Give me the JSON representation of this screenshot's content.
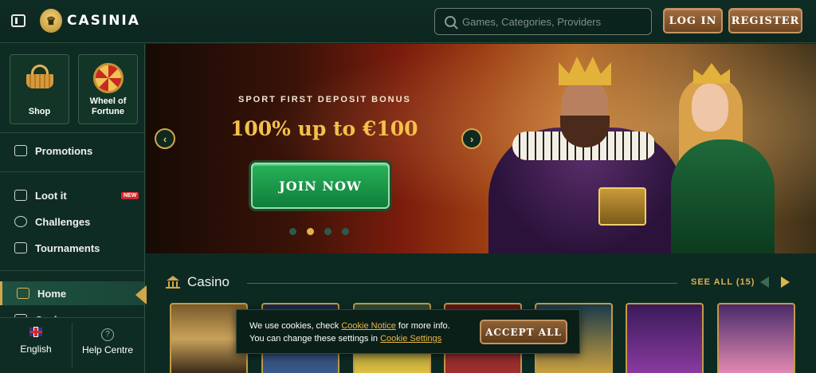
{
  "header": {
    "logo_text": "CASINIA",
    "search_placeholder": "Games, Categories, Providers",
    "login_label": "LOG IN",
    "register_label": "REGISTER"
  },
  "sidebar": {
    "tiles": [
      {
        "label": "Shop",
        "icon": "basket-icon"
      },
      {
        "label": "Wheel of Fortune",
        "icon": "wheel-icon"
      }
    ],
    "items": [
      {
        "label": "Promotions",
        "icon": "gift-box-icon"
      },
      {
        "label": "Loot it",
        "icon": "loot-box-icon",
        "badge": "NEW"
      },
      {
        "label": "Challenges",
        "icon": "challenge-icon"
      },
      {
        "label": "Tournaments",
        "icon": "trophy-icon"
      },
      {
        "label": "Home",
        "icon": "home-icon",
        "active": true
      },
      {
        "label": "Casino",
        "icon": "casino-icon"
      }
    ],
    "language": "English",
    "help": "Help Centre"
  },
  "hero": {
    "subtitle": "SPORT FIRST DEPOSIT BONUS",
    "title": "100% up to €100",
    "cta": "JOIN NOW",
    "slide_count": 4,
    "active_slide": 2
  },
  "casino": {
    "title": "Casino",
    "see_all": "SEE ALL (15)"
  },
  "cookie": {
    "line1_pre": "We use cookies, check ",
    "line1_link": "Cookie Notice",
    "line1_post": " for more info.",
    "line2_pre": "You can change these settings in ",
    "line2_link": "Cookie Settings",
    "accept": "ACCEPT ALL"
  },
  "colors": {
    "accent_gold": "#d2a64b",
    "background": "#0d2a22",
    "join_green": "#1f9a48",
    "button_brown": "#8a5a2e"
  }
}
